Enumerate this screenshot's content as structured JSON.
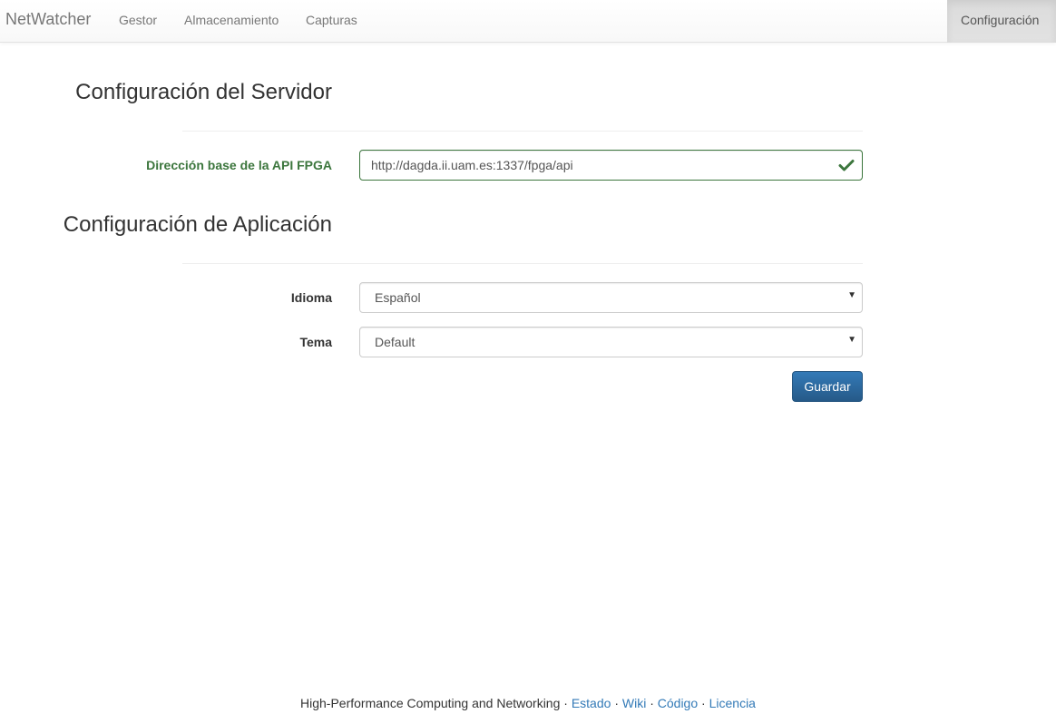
{
  "navbar": {
    "brand": "NetWatcher",
    "items": [
      {
        "label": "Gestor"
      },
      {
        "label": "Almacenamiento"
      },
      {
        "label": "Capturas"
      }
    ],
    "active_item": "Configuración"
  },
  "server_section": {
    "title": "Configuración del Servidor",
    "api_label": "Dirección base de la API FPGA",
    "api_value": "http://dagda.ii.uam.es:1337/fpga/api"
  },
  "app_section": {
    "title": "Configuración de Aplicación",
    "language_label": "Idioma",
    "language_value": "Español",
    "theme_label": "Tema",
    "theme_value": "Default",
    "save_label": "Guardar"
  },
  "footer": {
    "text": "High-Performance Computing and Networking",
    "sep": "·",
    "links": [
      "Estado",
      "Wiki",
      "Código",
      "Licencia"
    ]
  },
  "colors": {
    "success": "#3c763d",
    "primary": "#337ab7",
    "link": "#337ab7"
  },
  "icons": {
    "success_check": "check-icon",
    "select_caret": "caret-down-icon"
  }
}
